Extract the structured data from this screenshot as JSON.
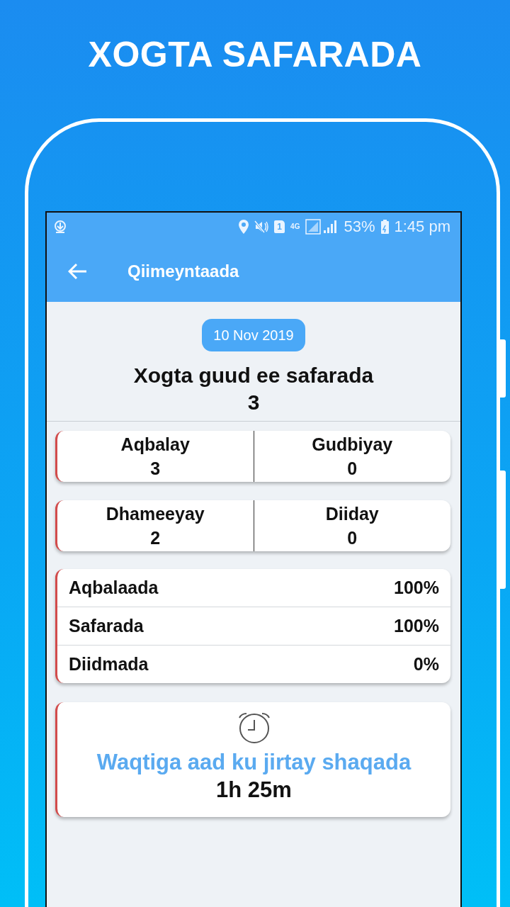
{
  "headline": "XOGTA SAFARADA",
  "status_bar": {
    "network_label": "4G",
    "sim_label": "1",
    "battery": "53%",
    "time": "1:45 pm"
  },
  "app_bar": {
    "title": "Qiimeyntaada"
  },
  "date": "10 Nov 2019",
  "summary": {
    "title": "Xogta guud ee safarada",
    "total": "3"
  },
  "stat_cards": [
    {
      "cells": [
        {
          "label": "Aqbalay",
          "value": "3"
        },
        {
          "label": "Gudbiyay",
          "value": "0"
        }
      ]
    },
    {
      "cells": [
        {
          "label": "Dhameeyay",
          "value": "2"
        },
        {
          "label": "Diiday",
          "value": "0"
        }
      ]
    }
  ],
  "rates": [
    {
      "label": "Aqbalaada",
      "value": "100%"
    },
    {
      "label": "Safarada",
      "value": "100%"
    },
    {
      "label": "Diidmada",
      "value": "0%"
    }
  ],
  "work_time": {
    "label": "Waqtiga aad ku jirtay shaqada",
    "value": "1h 25m"
  }
}
